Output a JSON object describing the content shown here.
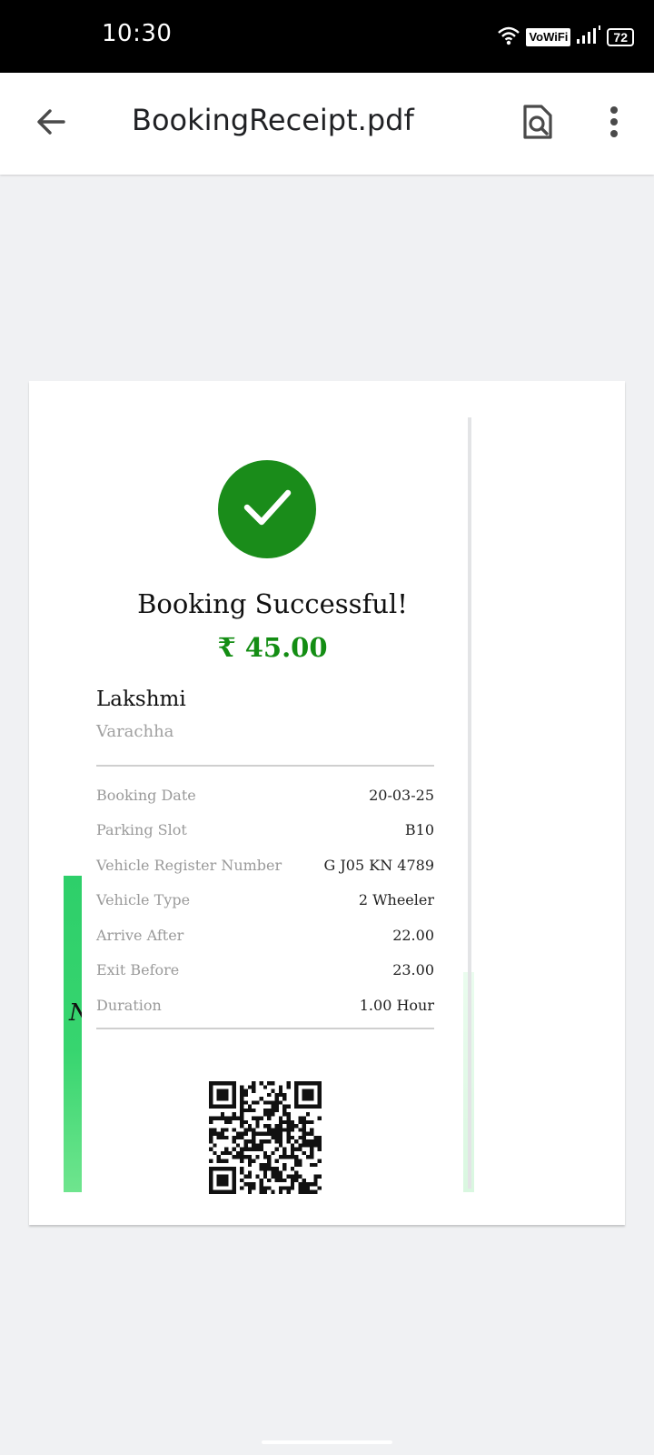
{
  "status_bar": {
    "time": "10:30",
    "vowifi": "VoWiFi",
    "battery": "72",
    "icons": [
      "wifi-icon",
      "signal-icon",
      "battery-icon"
    ]
  },
  "app_bar": {
    "title": "BookingReceipt.pdf",
    "icons": [
      "back-arrow-icon",
      "search-document-icon",
      "more-vert-icon"
    ]
  },
  "receipt": {
    "status_icon": "checkmark-icon",
    "title": "Booking Successful!",
    "amount": "₹ 45.00",
    "customer_name": "Lakshmi",
    "location": "Varachha",
    "details": [
      {
        "label": "Booking Date",
        "value": "20-03-25"
      },
      {
        "label": "Parking Slot",
        "value": "B10"
      },
      {
        "label": "Vehicle Register Number",
        "value": "G J05 KN 4789"
      },
      {
        "label": "Vehicle Type",
        "value": "2 Wheeler"
      },
      {
        "label": "Arrive After",
        "value": "22.00"
      },
      {
        "label": "Exit Before",
        "value": "23.00"
      },
      {
        "label": "Duration",
        "value": "1.00 Hour"
      }
    ],
    "qr_icon": "qr-code-icon"
  },
  "colors": {
    "success_green": "#1a8c1a",
    "amount_green": "#138d13",
    "strip_green": "#2ecf6a",
    "app_bar_bg": "#ffffff",
    "viewer_bg": "#f0f1f3"
  }
}
